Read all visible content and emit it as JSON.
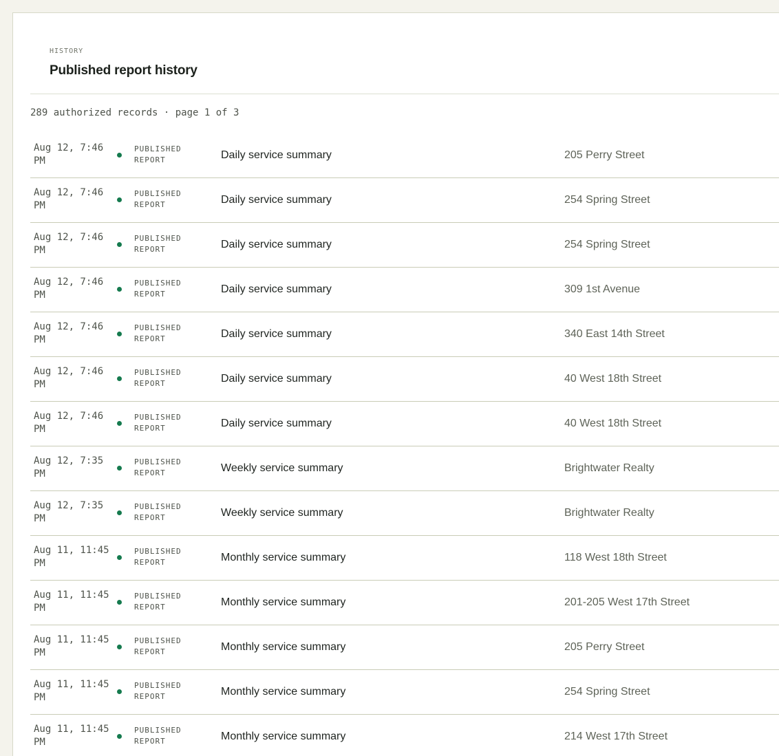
{
  "colors": {
    "background": "#f4f3ec",
    "panel": "#ffffff",
    "status_dot": "#157a4e",
    "row_divider": "#c9ccb6"
  },
  "header": {
    "eyebrow": "HISTORY",
    "title": "Published report history"
  },
  "summary": "289 authorized records · page 1 of 3",
  "rows": [
    {
      "time": "Aug 12, 7:46 PM",
      "status": "PUBLISHED REPORT",
      "title": "Daily service summary",
      "location": "205 Perry Street"
    },
    {
      "time": "Aug 12, 7:46 PM",
      "status": "PUBLISHED REPORT",
      "title": "Daily service summary",
      "location": "254 Spring Street"
    },
    {
      "time": "Aug 12, 7:46 PM",
      "status": "PUBLISHED REPORT",
      "title": "Daily service summary",
      "location": "254 Spring Street"
    },
    {
      "time": "Aug 12, 7:46 PM",
      "status": "PUBLISHED REPORT",
      "title": "Daily service summary",
      "location": "309 1st Avenue"
    },
    {
      "time": "Aug 12, 7:46 PM",
      "status": "PUBLISHED REPORT",
      "title": "Daily service summary",
      "location": "340 East 14th Street"
    },
    {
      "time": "Aug 12, 7:46 PM",
      "status": "PUBLISHED REPORT",
      "title": "Daily service summary",
      "location": "40 West 18th Street"
    },
    {
      "time": "Aug 12, 7:46 PM",
      "status": "PUBLISHED REPORT",
      "title": "Daily service summary",
      "location": "40 West 18th Street"
    },
    {
      "time": "Aug 12, 7:35 PM",
      "status": "PUBLISHED REPORT",
      "title": "Weekly service summary",
      "location": "Brightwater Realty"
    },
    {
      "time": "Aug 12, 7:35 PM",
      "status": "PUBLISHED REPORT",
      "title": "Weekly service summary",
      "location": "Brightwater Realty"
    },
    {
      "time": "Aug 11, 11:45 PM",
      "status": "PUBLISHED REPORT",
      "title": "Monthly service summary",
      "location": "118 West 18th Street"
    },
    {
      "time": "Aug 11, 11:45 PM",
      "status": "PUBLISHED REPORT",
      "title": "Monthly service summary",
      "location": "201-205 West 17th Street"
    },
    {
      "time": "Aug 11, 11:45 PM",
      "status": "PUBLISHED REPORT",
      "title": "Monthly service summary",
      "location": "205 Perry Street"
    },
    {
      "time": "Aug 11, 11:45 PM",
      "status": "PUBLISHED REPORT",
      "title": "Monthly service summary",
      "location": "254 Spring Street"
    },
    {
      "time": "Aug 11, 11:45 PM",
      "status": "PUBLISHED REPORT",
      "title": "Monthly service summary",
      "location": "214 West 17th Street"
    }
  ]
}
